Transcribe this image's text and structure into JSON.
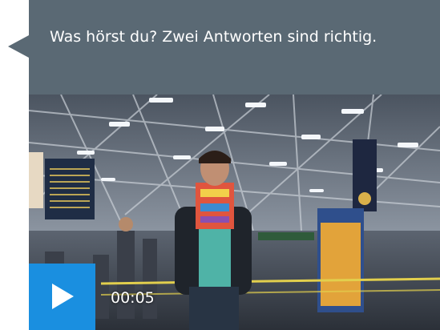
{
  "question": {
    "text": "Was hörst du? Zwei Antworten sind richtig."
  },
  "video": {
    "play_icon": "play-icon",
    "time": "00:05"
  },
  "colors": {
    "bubble": "#5a6974",
    "play_button": "#1a8fe0",
    "text": "#ffffff"
  }
}
